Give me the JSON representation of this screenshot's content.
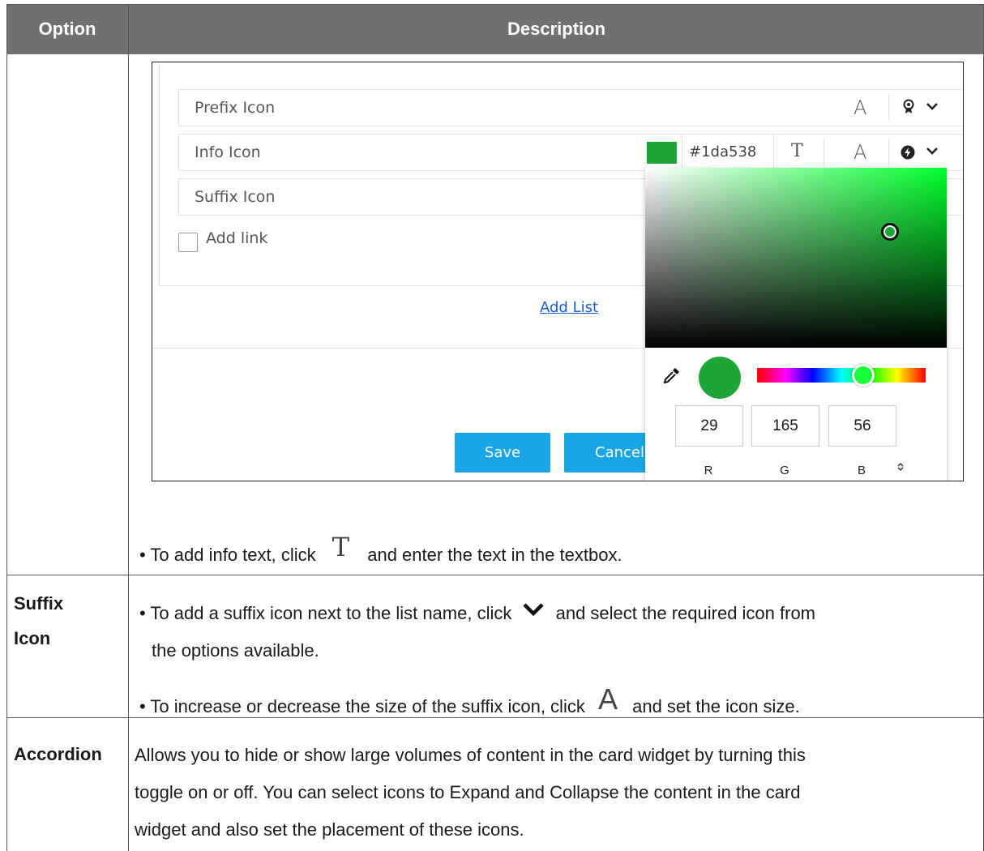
{
  "header": {
    "option": "Option",
    "description": "Description"
  },
  "screenshot": {
    "rows": [
      {
        "label": "Prefix Icon"
      },
      {
        "label": "Info Icon",
        "hex": "#1da538"
      },
      {
        "label": "Suffix Icon"
      }
    ],
    "add_link": "Add link",
    "add_list": "Add List",
    "save": "Save",
    "cancel": "Cancel",
    "text_icon": "T",
    "size_icon": "A",
    "picker": {
      "color": "#1da538",
      "r": "29",
      "g": "165",
      "b": "56",
      "r_label": "R",
      "g_label": "G",
      "b_label": "B"
    }
  },
  "rows": [
    {
      "option": "",
      "lines": [
        "• To add info text, click",
        "and enter the text in the textbox."
      ],
      "inline_icon": "T"
    },
    {
      "option_line1": "Suffix",
      "option_line2": "Icon",
      "line1a": "• To add a suffix icon next to the list name, click",
      "line1b": "and select the required icon from",
      "line1c": "the options available.",
      "line2a": "• To increase or decrease the size of the suffix icon, click",
      "line2b": "and set the icon size.",
      "inline_icon_size": "A"
    },
    {
      "option": "Accordion",
      "text_lines": [
        "Allows you to hide or show large volumes of content in the card widget by turning this",
        "toggle on or off. You can select icons to Expand and Collapse the content in the card",
        "widget and also set the placement of these icons."
      ]
    }
  ]
}
